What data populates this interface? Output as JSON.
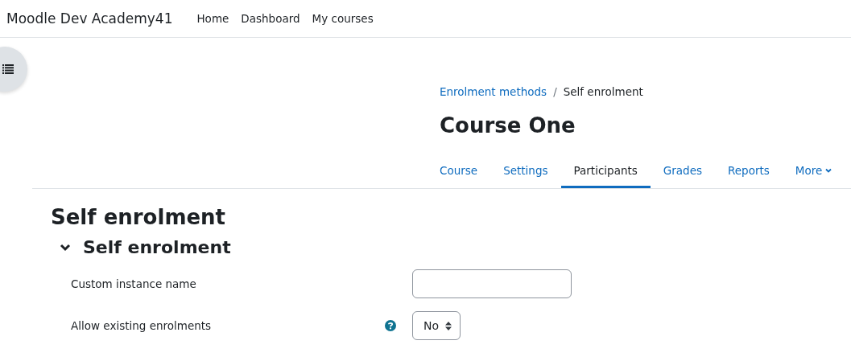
{
  "navbar": {
    "site_name": "Moodle Dev Academy41",
    "links": [
      "Home",
      "Dashboard",
      "My courses"
    ]
  },
  "breadcrumb": [
    {
      "label": "Enrolment methods",
      "kind": "link"
    },
    {
      "label": "/",
      "kind": "separator"
    },
    {
      "label": "Self enrolment",
      "kind": "current"
    }
  ],
  "course_title": "Course One",
  "tabs": [
    {
      "label": "Course",
      "selected": false
    },
    {
      "label": "Settings",
      "selected": false
    },
    {
      "label": "Participants",
      "selected": true
    },
    {
      "label": "Grades",
      "selected": false
    },
    {
      "label": "Reports",
      "selected": false
    },
    {
      "label": "More",
      "selected": false,
      "kind": "dropdown"
    }
  ],
  "page_heading": "Self enrolment",
  "section": {
    "title": "Self enrolment",
    "expanded": true,
    "fields": [
      {
        "label": "Custom instance name",
        "kind": "text",
        "help": false
      },
      {
        "label": "Allow existing enrolments",
        "kind": "select",
        "help": true,
        "value": "No"
      }
    ]
  }
}
